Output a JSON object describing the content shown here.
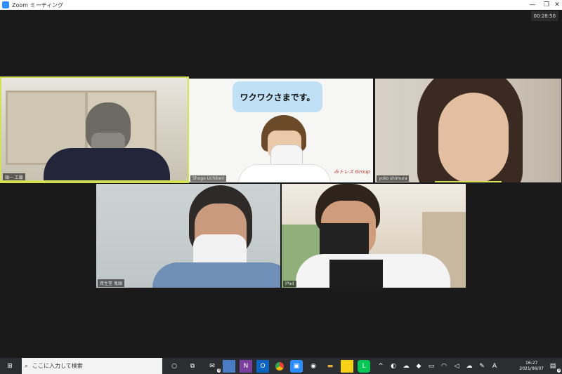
{
  "window": {
    "title": "Zoom ミーティング",
    "timer": "00:28:50"
  },
  "participants": [
    {
      "name": "順一 工藤",
      "speaking": true
    },
    {
      "name": "Shogo Uchibori",
      "sign": "ワクワクさまです。",
      "brand": "みトレス Group"
    },
    {
      "name": "yoko shimura"
    },
    {
      "name": "資生堂 鬼頭"
    },
    {
      "name": "iPad"
    }
  ],
  "taskbar": {
    "search_placeholder": "ここに入力して検索",
    "mail_badge": "3",
    "time": "16:27",
    "date": "2021/06/07",
    "notification_badge": "3",
    "ime": "A"
  }
}
